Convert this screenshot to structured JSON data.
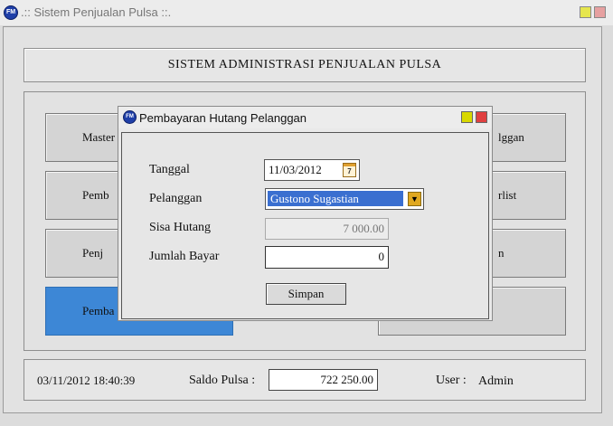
{
  "window": {
    "title": ".:: Sistem Penjualan Pulsa ::.",
    "icon": "app-logo-icon",
    "controls": {
      "minimize_color": "#e6e64d",
      "close_color": "#e6a0a0"
    }
  },
  "header": {
    "title": "SISTEM ADMINISTRASI PENJUALAN PULSA"
  },
  "menu": {
    "left": [
      {
        "label": "Master"
      },
      {
        "label": "Pemb"
      },
      {
        "label": "Penj"
      },
      {
        "label": "Pemba"
      }
    ],
    "right": [
      {
        "label": "lggan"
      },
      {
        "label": "rlist"
      },
      {
        "label": "n"
      },
      {
        "label": ""
      }
    ],
    "active_color": "#3d87d6"
  },
  "status_bar": {
    "datetime": "03/11/2012 18:40:39",
    "saldo_label": "Saldo Pulsa :",
    "saldo_value": "722 250.00",
    "user_label": "User :",
    "user_value": "Admin"
  },
  "dialog": {
    "title": "Pembayaran Hutang Pelanggan",
    "controls": {
      "minimize_color": "#d8d800",
      "close_color": "#e04040"
    },
    "fields": {
      "tanggal_label": "Tanggal",
      "tanggal_value": "11/03/2012",
      "pelanggan_label": "Pelanggan",
      "pelanggan_value": "Gustono Sugastian",
      "sisa_label": "Sisa Hutang",
      "sisa_value": "7 000.00",
      "jumlah_label": "Jumlah Bayar",
      "jumlah_value": "0"
    },
    "save_label": "Simpan"
  }
}
